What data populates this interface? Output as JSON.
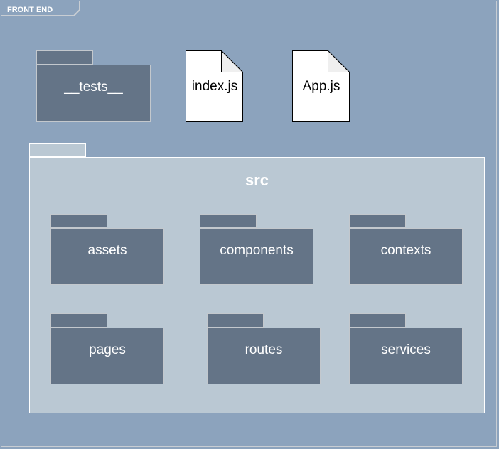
{
  "frame": {
    "label": "FRONT END"
  },
  "top_items": {
    "tests_folder": "__tests__",
    "files": [
      "index.js",
      "App.js"
    ]
  },
  "src": {
    "title": "src",
    "folders": [
      "assets",
      "components",
      "contexts",
      "pages",
      "routes",
      "services"
    ]
  },
  "colors": {
    "background": "#8ca3bd",
    "folder_fill": "#647487",
    "src_fill": "#bac8d3",
    "file_fill": "#ffffff"
  }
}
